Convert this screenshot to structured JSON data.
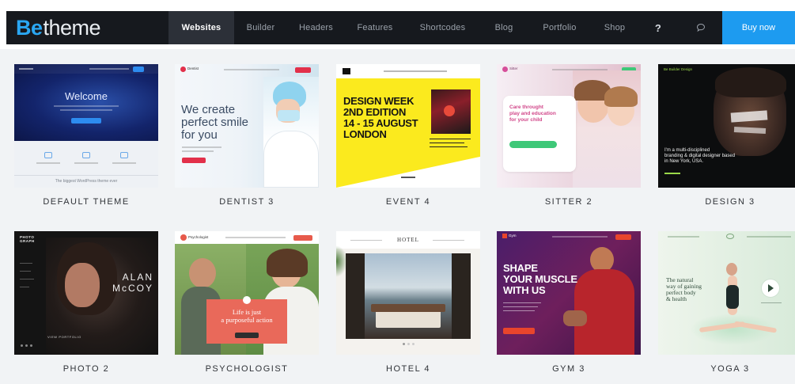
{
  "brand": {
    "be": "Be",
    "theme": "theme"
  },
  "nav": {
    "items": [
      "Websites",
      "Builder",
      "Headers",
      "Features",
      "Shortcodes",
      "Blog",
      "Portfolio",
      "Shop"
    ],
    "help": "?",
    "buy": "Buy now"
  },
  "colors": {
    "nav_bg": "#16191e",
    "accent": "#1d9bf0",
    "active_tab": "#2c3038"
  },
  "cards": [
    {
      "label": "DEFAULT THEME",
      "welcome": "Welcome",
      "footer": "The biggest WordPress theme ever"
    },
    {
      "label": "DENTIST 3",
      "logo": "Dentist",
      "headline": [
        "We create",
        "perfect smile",
        "for you"
      ]
    },
    {
      "label": "EVENT 4",
      "headline": [
        "DESIGN WEEK",
        "2ND EDITION",
        "14 - 15 AUGUST",
        "LONDON"
      ]
    },
    {
      "label": "SITTER 2",
      "logo": "Sitter",
      "headline": [
        "Care throught",
        "play and education",
        "for your child"
      ]
    },
    {
      "label": "DESIGN 3",
      "logo": "Be Builder Design",
      "headline": [
        "I'm a multi-disciplined",
        "branding & digital designer based",
        "in New York, USA."
      ]
    },
    {
      "label": "PHOTO 2",
      "logo": [
        "PHOTO",
        "GRAPH"
      ],
      "headline": [
        "ALAN",
        "McCOY"
      ],
      "caption": "VIEW PORTFOLIO"
    },
    {
      "label": "PSYCHOLOGIST",
      "logo": "Psychologist",
      "headline": [
        "Life is just",
        "a purposeful action"
      ]
    },
    {
      "label": "HOTEL 4",
      "logo": "HOTEL"
    },
    {
      "label": "GYM 3",
      "logo": "Gym",
      "headline": [
        "SHAPE",
        "YOUR MUSCLE",
        "WITH US"
      ]
    },
    {
      "label": "YOGA 3",
      "headline": [
        "The natural",
        "way of gaining",
        "perfect body",
        "& health"
      ]
    }
  ]
}
